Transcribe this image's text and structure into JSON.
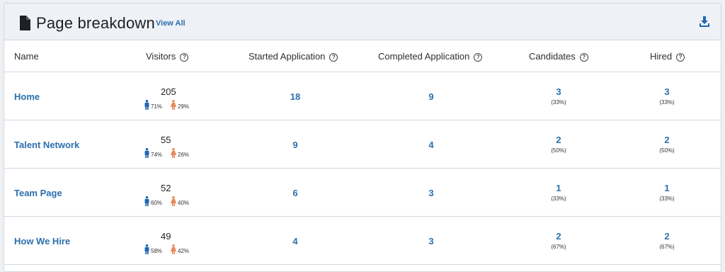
{
  "header": {
    "title": "Page breakdown",
    "view_all": "View All",
    "icons": [
      "document-icon",
      "download-icon"
    ]
  },
  "columns": {
    "name": "Name",
    "visitors": "Visitors",
    "started": "Started Application",
    "completed": "Completed Application",
    "candidates": "Candidates",
    "hired": "Hired",
    "help_glyph": "?"
  },
  "colors": {
    "link": "#2c6fad",
    "male": "#1f66b0",
    "female": "#e8895a",
    "header_bg": "#eef1f5"
  },
  "rows": [
    {
      "name": "Home",
      "visitors": "205",
      "male": "71%",
      "female": "29%",
      "started": "18",
      "completed": "9",
      "candidates": "3",
      "candidates_pct": "(33%)",
      "hired": "3",
      "hired_pct": "(33%)"
    },
    {
      "name": "Talent Network",
      "visitors": "55",
      "male": "74%",
      "female": "26%",
      "started": "9",
      "completed": "4",
      "candidates": "2",
      "candidates_pct": "(50%)",
      "hired": "2",
      "hired_pct": "(50%)"
    },
    {
      "name": "Team Page",
      "visitors": "52",
      "male": "60%",
      "female": "40%",
      "started": "6",
      "completed": "3",
      "candidates": "1",
      "candidates_pct": "(33%)",
      "hired": "1",
      "hired_pct": "(33%)"
    },
    {
      "name": "How We Hire",
      "visitors": "49",
      "male": "58%",
      "female": "42%",
      "started": "4",
      "completed": "3",
      "candidates": "2",
      "candidates_pct": "(67%)",
      "hired": "2",
      "hired_pct": "(67%)"
    }
  ]
}
